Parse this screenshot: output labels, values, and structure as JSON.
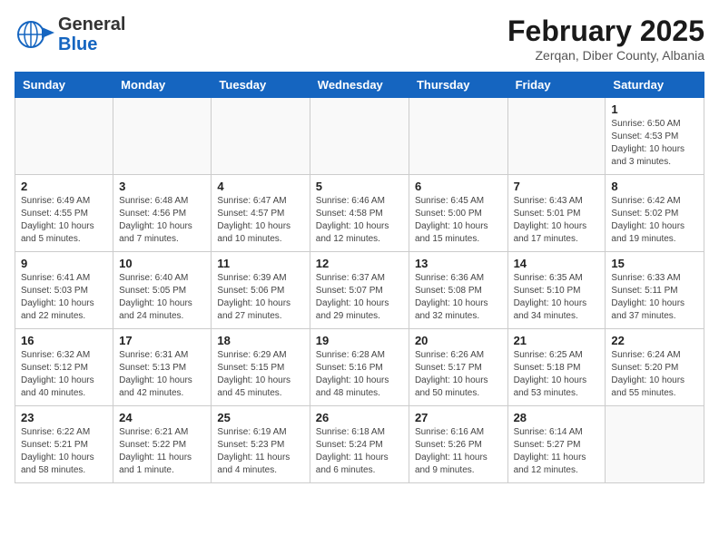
{
  "header": {
    "logo_general": "General",
    "logo_blue": "Blue",
    "month_year": "February 2025",
    "location": "Zerqan, Diber County, Albania"
  },
  "days_of_week": [
    "Sunday",
    "Monday",
    "Tuesday",
    "Wednesday",
    "Thursday",
    "Friday",
    "Saturday"
  ],
  "weeks": [
    [
      {
        "day": "",
        "info": ""
      },
      {
        "day": "",
        "info": ""
      },
      {
        "day": "",
        "info": ""
      },
      {
        "day": "",
        "info": ""
      },
      {
        "day": "",
        "info": ""
      },
      {
        "day": "",
        "info": ""
      },
      {
        "day": "1",
        "info": "Sunrise: 6:50 AM\nSunset: 4:53 PM\nDaylight: 10 hours and 3 minutes."
      }
    ],
    [
      {
        "day": "2",
        "info": "Sunrise: 6:49 AM\nSunset: 4:55 PM\nDaylight: 10 hours and 5 minutes."
      },
      {
        "day": "3",
        "info": "Sunrise: 6:48 AM\nSunset: 4:56 PM\nDaylight: 10 hours and 7 minutes."
      },
      {
        "day": "4",
        "info": "Sunrise: 6:47 AM\nSunset: 4:57 PM\nDaylight: 10 hours and 10 minutes."
      },
      {
        "day": "5",
        "info": "Sunrise: 6:46 AM\nSunset: 4:58 PM\nDaylight: 10 hours and 12 minutes."
      },
      {
        "day": "6",
        "info": "Sunrise: 6:45 AM\nSunset: 5:00 PM\nDaylight: 10 hours and 15 minutes."
      },
      {
        "day": "7",
        "info": "Sunrise: 6:43 AM\nSunset: 5:01 PM\nDaylight: 10 hours and 17 minutes."
      },
      {
        "day": "8",
        "info": "Sunrise: 6:42 AM\nSunset: 5:02 PM\nDaylight: 10 hours and 19 minutes."
      }
    ],
    [
      {
        "day": "9",
        "info": "Sunrise: 6:41 AM\nSunset: 5:03 PM\nDaylight: 10 hours and 22 minutes."
      },
      {
        "day": "10",
        "info": "Sunrise: 6:40 AM\nSunset: 5:05 PM\nDaylight: 10 hours and 24 minutes."
      },
      {
        "day": "11",
        "info": "Sunrise: 6:39 AM\nSunset: 5:06 PM\nDaylight: 10 hours and 27 minutes."
      },
      {
        "day": "12",
        "info": "Sunrise: 6:37 AM\nSunset: 5:07 PM\nDaylight: 10 hours and 29 minutes."
      },
      {
        "day": "13",
        "info": "Sunrise: 6:36 AM\nSunset: 5:08 PM\nDaylight: 10 hours and 32 minutes."
      },
      {
        "day": "14",
        "info": "Sunrise: 6:35 AM\nSunset: 5:10 PM\nDaylight: 10 hours and 34 minutes."
      },
      {
        "day": "15",
        "info": "Sunrise: 6:33 AM\nSunset: 5:11 PM\nDaylight: 10 hours and 37 minutes."
      }
    ],
    [
      {
        "day": "16",
        "info": "Sunrise: 6:32 AM\nSunset: 5:12 PM\nDaylight: 10 hours and 40 minutes."
      },
      {
        "day": "17",
        "info": "Sunrise: 6:31 AM\nSunset: 5:13 PM\nDaylight: 10 hours and 42 minutes."
      },
      {
        "day": "18",
        "info": "Sunrise: 6:29 AM\nSunset: 5:15 PM\nDaylight: 10 hours and 45 minutes."
      },
      {
        "day": "19",
        "info": "Sunrise: 6:28 AM\nSunset: 5:16 PM\nDaylight: 10 hours and 48 minutes."
      },
      {
        "day": "20",
        "info": "Sunrise: 6:26 AM\nSunset: 5:17 PM\nDaylight: 10 hours and 50 minutes."
      },
      {
        "day": "21",
        "info": "Sunrise: 6:25 AM\nSunset: 5:18 PM\nDaylight: 10 hours and 53 minutes."
      },
      {
        "day": "22",
        "info": "Sunrise: 6:24 AM\nSunset: 5:20 PM\nDaylight: 10 hours and 55 minutes."
      }
    ],
    [
      {
        "day": "23",
        "info": "Sunrise: 6:22 AM\nSunset: 5:21 PM\nDaylight: 10 hours and 58 minutes."
      },
      {
        "day": "24",
        "info": "Sunrise: 6:21 AM\nSunset: 5:22 PM\nDaylight: 11 hours and 1 minute."
      },
      {
        "day": "25",
        "info": "Sunrise: 6:19 AM\nSunset: 5:23 PM\nDaylight: 11 hours and 4 minutes."
      },
      {
        "day": "26",
        "info": "Sunrise: 6:18 AM\nSunset: 5:24 PM\nDaylight: 11 hours and 6 minutes."
      },
      {
        "day": "27",
        "info": "Sunrise: 6:16 AM\nSunset: 5:26 PM\nDaylight: 11 hours and 9 minutes."
      },
      {
        "day": "28",
        "info": "Sunrise: 6:14 AM\nSunset: 5:27 PM\nDaylight: 11 hours and 12 minutes."
      },
      {
        "day": "",
        "info": ""
      }
    ]
  ]
}
